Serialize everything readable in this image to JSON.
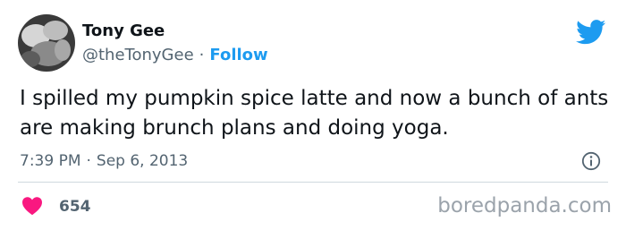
{
  "author": {
    "display_name": "Tony Gee",
    "handle": "@theTonyGee",
    "separator": "·",
    "follow_label": "Follow"
  },
  "tweet": {
    "text": "I spilled my pumpkin spice latte and now a bunch of ants are making brunch plans and doing yoga.",
    "time": "7:39 PM",
    "date": "Sep 6, 2013"
  },
  "engagement": {
    "like_count": "654"
  },
  "watermark": "boredpanda.com",
  "colors": {
    "accent": "#1d9bf0",
    "like_heart": "#f91880",
    "secondary_text": "#536471",
    "primary_text": "#0f1419"
  },
  "icons": {
    "brand": "twitter-bird-icon",
    "info": "info-icon",
    "like": "heart-icon"
  }
}
